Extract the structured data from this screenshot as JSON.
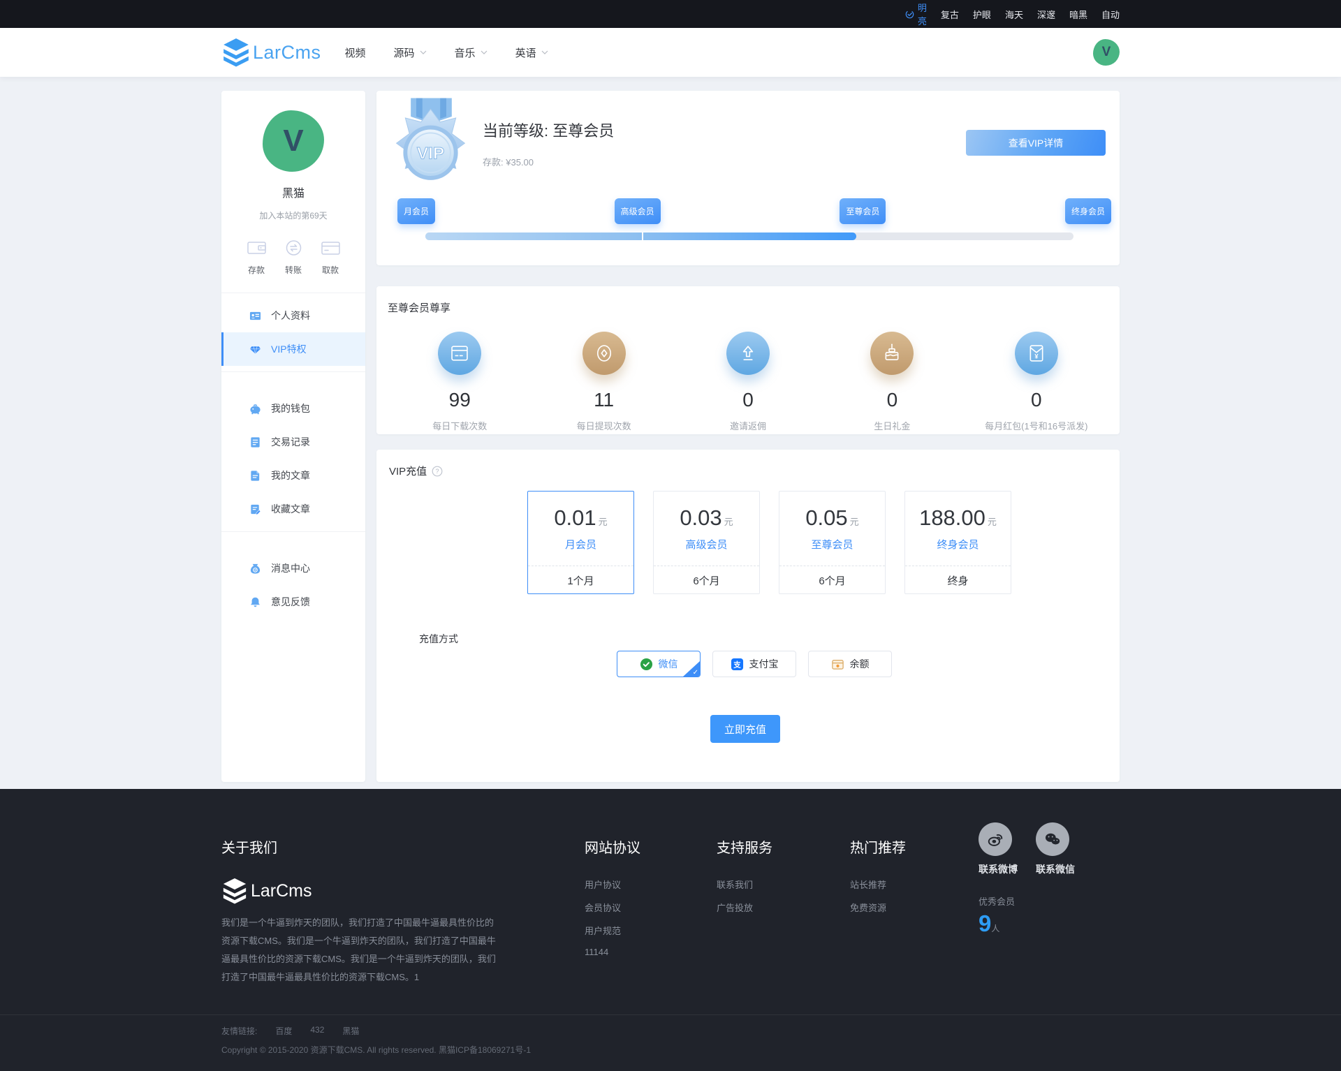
{
  "theme_bar": {
    "items": [
      {
        "label": "明亮",
        "active": true
      },
      {
        "label": "复古",
        "active": false
      },
      {
        "label": "护眼",
        "active": false
      },
      {
        "label": "海天",
        "active": false
      },
      {
        "label": "深邃",
        "active": false
      },
      {
        "label": "暗黑",
        "active": false
      },
      {
        "label": "自动",
        "active": false
      }
    ]
  },
  "header": {
    "logo_text": "LarCms",
    "nav": [
      {
        "label": "视频",
        "dropdown": false
      },
      {
        "label": "源码",
        "dropdown": true
      },
      {
        "label": "音乐",
        "dropdown": true
      },
      {
        "label": "英语",
        "dropdown": true
      }
    ],
    "avatar_letter": "V"
  },
  "sidebar": {
    "avatar_letter": "V",
    "username": "黑猫",
    "join_text": "加入本站的第69天",
    "wallet_actions": [
      {
        "label": "存款"
      },
      {
        "label": "转账"
      },
      {
        "label": "取款"
      }
    ],
    "menu_group1": [
      {
        "label": "个人资料",
        "active": false
      },
      {
        "label": "VIP特权",
        "active": true
      }
    ],
    "menu_group2": [
      {
        "label": "我的钱包"
      },
      {
        "label": "交易记录"
      },
      {
        "label": "我的文章"
      },
      {
        "label": "收藏文章"
      }
    ],
    "menu_group3": [
      {
        "label": "消息中心"
      },
      {
        "label": "意见反馈"
      }
    ]
  },
  "level_card": {
    "medal_text": "VIP",
    "title": "当前等级: 至尊会员",
    "deposit_label": "存款:",
    "deposit_value": "¥35.00",
    "detail_button": "查看VIP详情",
    "levels": [
      "月会员",
      "高级会员",
      "至尊会员",
      "终身会员"
    ],
    "progress_percent": 66.5
  },
  "privilege_card": {
    "title": "至尊会员尊享",
    "items": [
      {
        "value": "99",
        "label": "每日下载次数",
        "color": "blue"
      },
      {
        "value": "11",
        "label": "每日提现次数",
        "color": "tan"
      },
      {
        "value": "0",
        "label": "邀请返佣",
        "color": "blue"
      },
      {
        "value": "0",
        "label": "生日礼金",
        "color": "tan"
      },
      {
        "value": "0",
        "label": "每月红包(1号和16号派发)",
        "color": "blue"
      }
    ]
  },
  "recharge_card": {
    "title": "VIP充值",
    "plans": [
      {
        "price": "0.01",
        "unit": "元",
        "name": "月会员",
        "duration": "1个月",
        "selected": true
      },
      {
        "price": "0.03",
        "unit": "元",
        "name": "高级会员",
        "duration": "6个月",
        "selected": false
      },
      {
        "price": "0.05",
        "unit": "元",
        "name": "至尊会员",
        "duration": "6个月",
        "selected": false
      },
      {
        "price": "188.00",
        "unit": "元",
        "name": "终身会员",
        "duration": "终身",
        "selected": false
      }
    ],
    "method_label": "充值方式",
    "methods": [
      {
        "label": "微信",
        "selected": true
      },
      {
        "label": "支付宝",
        "selected": false
      },
      {
        "label": "余额",
        "selected": false
      }
    ],
    "submit_button": "立即充值"
  },
  "footer": {
    "about": {
      "title": "关于我们",
      "logo_text": "LarCms",
      "description": "我们是一个牛逼到炸天的团队，我们打造了中国最牛逼最具性价比的资源下载CMS。我们是一个牛逼到炸天的团队，我们打造了中国最牛逼最具性价比的资源下载CMS。我们是一个牛逼到炸天的团队，我们打造了中国最牛逼最具性价比的资源下载CMS。1"
    },
    "protocol": {
      "title": "网站协议",
      "links": [
        {
          "label": "用户协议"
        },
        {
          "label": "会员协议"
        },
        {
          "label": "用户规范"
        },
        {
          "label": "11144"
        }
      ]
    },
    "support": {
      "title": "支持服务",
      "links": [
        {
          "label": "联系我们"
        },
        {
          "label": "广告投放"
        }
      ]
    },
    "hot": {
      "title": "热门推荐",
      "links": [
        {
          "label": "站长推荐"
        },
        {
          "label": "免费资源"
        }
      ]
    },
    "contact": {
      "weibo_label": "联系微博",
      "wechat_label": "联系微信",
      "member_label": "优秀会员",
      "member_count": "9",
      "member_unit": "人"
    },
    "bottom": {
      "friend_label": "友情链接:",
      "friend_links": [
        {
          "label": "百度"
        },
        {
          "label": "432"
        },
        {
          "label": "黑猫"
        }
      ],
      "copyright": "Copyright © 2015-2020 资源下载CMS. All rights reserved. 黑猫ICP备18069271号-1"
    }
  },
  "colors": {
    "primary": "#3e8ef7",
    "wechat_green": "#2ba245",
    "alipay_blue": "#1677ff",
    "avatar_green": "#49b583",
    "footer_bg": "#20232b",
    "circle_blue": "#5fa7e2",
    "circle_tan": "#c09a6d"
  }
}
